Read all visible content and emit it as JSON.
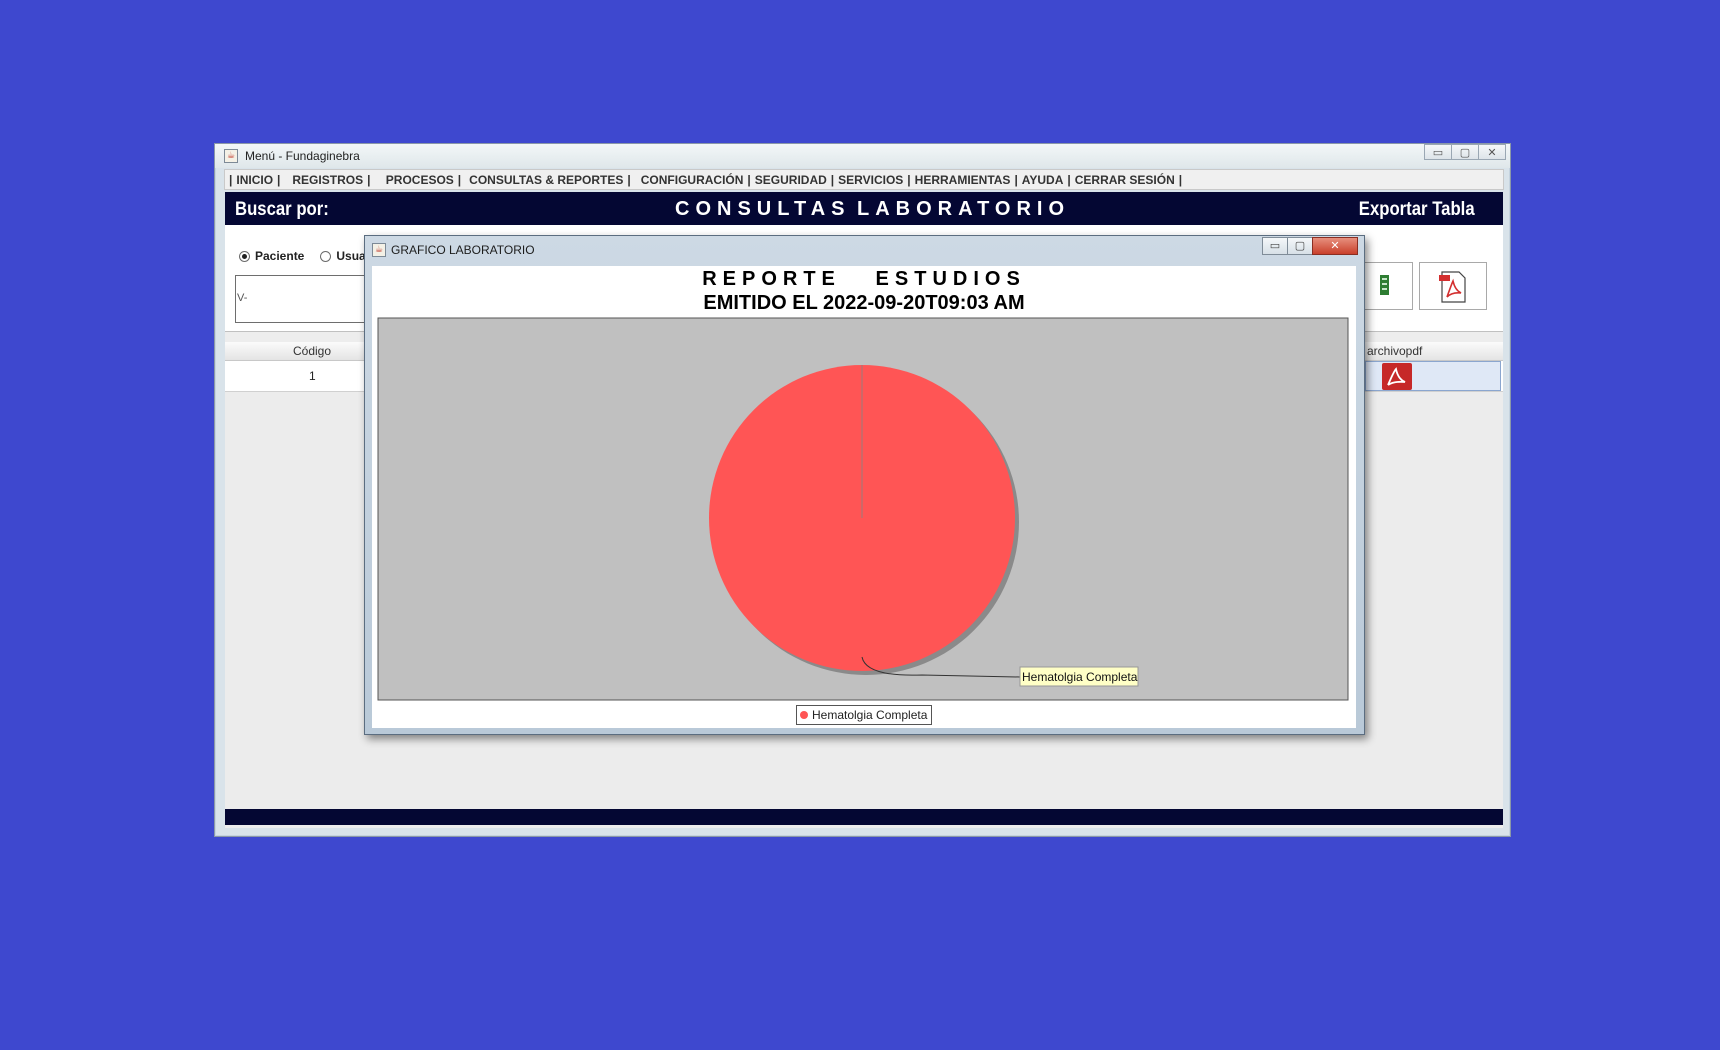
{
  "window": {
    "title": "Menú - Fundaginebra",
    "controls": [
      "▭",
      "▢",
      "✕"
    ]
  },
  "menubar": {
    "items": [
      "INICIO",
      "REGISTROS",
      " PROCESOS",
      "CONSULTAS & REPORTES",
      "CONFIGURACIÓN",
      "SEGURIDAD",
      "SERVICIOS",
      "HERRAMIENTAS",
      "AYUDA",
      "CERRAR SESIÓN"
    ],
    "separator": "|"
  },
  "header": {
    "search_by": "Buscar por:",
    "title_left": "CONSULTAS",
    "title_right": "LABORATORIO",
    "export": "Exportar Tabla"
  },
  "search": {
    "radio_paciente": "Paciente",
    "radio_usuario": "Usua",
    "input_value": "V-"
  },
  "table": {
    "columns": [
      "Código",
      "archivopdf"
    ],
    "rows": [
      {
        "codigo": "1"
      }
    ]
  },
  "dialog": {
    "title": "GRAFICO LABORATORIO",
    "controls": [
      "▭",
      "▢",
      "✕"
    ]
  },
  "chart_data": {
    "type": "pie",
    "title": "REPORTE   ESTUDIOS",
    "subtitle": "EMITIDO EL 2022-09-20T09:03 AM",
    "categories": [
      "Hematolgia Completa"
    ],
    "values": [
      100
    ],
    "colors": [
      "#ff5555"
    ],
    "labels": [
      "Hematolgia Completa"
    ],
    "legend": "bottom-center",
    "plot_background": "#c0c0c0"
  }
}
